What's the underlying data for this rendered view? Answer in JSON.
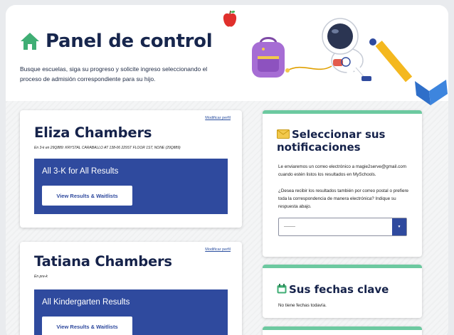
{
  "header": {
    "title": "Panel de control",
    "intro": "Busque escuelas, siga su progreso y solicite ingreso seleccionando el proceso de admisión correspondiente para su hijo."
  },
  "students": [
    {
      "name": "Eliza Chambers",
      "modify_label": "Modificar perfil",
      "school": "En 3-k en 29Q889: KRYSTAL CARABALLO AT 138-06 229ST FLOOR 1ST, NONE (29Q889)",
      "results_title": "All 3-K for All Results",
      "results_button": "View Results & Waitlists"
    },
    {
      "name": "Tatiana Chambers",
      "modify_label": "Modificar perfil",
      "school": "En pre-k",
      "results_title": "All Kindergarten Results",
      "results_button": "View Results & Waitlists"
    }
  ],
  "notifications": {
    "icon": "envelope-icon",
    "title": "Seleccionar sus notificaciones",
    "text1": "Le enviaremos un correo electrónico a magie2serve@gmail.com cuando estén listos los resultados en MySchools.",
    "text2": "¿Desea recibir los resultados también por correo postal o prefiere toda la correspondencia de manera electrónica? Indique su respuesta abajo.",
    "select_value": "--------",
    "select_arrow": "▼"
  },
  "key_dates": {
    "icon": "calendar-icon",
    "title": "Sus fechas clave",
    "text": "No tiene fechas todavía."
  },
  "colors": {
    "navy": "#15224a",
    "results_blue": "#2f4a9e",
    "accent_green": "#6cc9a0",
    "house_green": "#3fae74"
  }
}
